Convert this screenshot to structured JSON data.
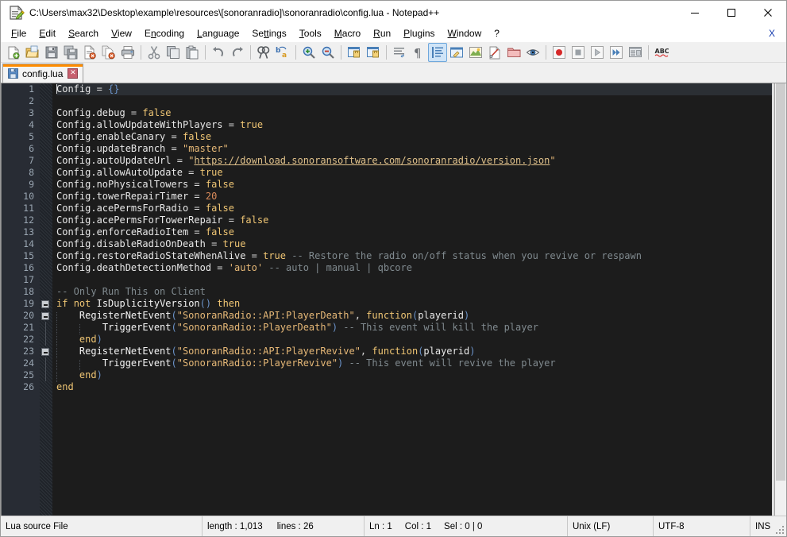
{
  "window": {
    "title": "C:\\Users\\max32\\Desktop\\example\\resources\\[sonoranradio]\\sonoranradio\\config.lua - Notepad++",
    "icon": "notepad-plus-plus-icon",
    "minimize_label": "—",
    "maximize_label": "☐",
    "close_label": "✕"
  },
  "menu": {
    "items": [
      {
        "label": "File",
        "accel": "F"
      },
      {
        "label": "Edit",
        "accel": "E"
      },
      {
        "label": "Search",
        "accel": "S"
      },
      {
        "label": "View",
        "accel": "V"
      },
      {
        "label": "Encoding",
        "accel": "n"
      },
      {
        "label": "Language",
        "accel": "L"
      },
      {
        "label": "Settings",
        "accel": "t"
      },
      {
        "label": "Tools",
        "accel": "T"
      },
      {
        "label": "Macro",
        "accel": "M"
      },
      {
        "label": "Run",
        "accel": "R"
      },
      {
        "label": "Plugins",
        "accel": "P"
      },
      {
        "label": "Window",
        "accel": "W"
      },
      {
        "label": "?",
        "accel": ""
      }
    ],
    "close_doc_label": "X"
  },
  "toolbar": {
    "buttons": [
      {
        "name": "new-file-icon",
        "tooltip": "New"
      },
      {
        "name": "open-file-icon",
        "tooltip": "Open"
      },
      {
        "name": "save-icon",
        "tooltip": "Save"
      },
      {
        "name": "save-all-icon",
        "tooltip": "Save All"
      },
      {
        "name": "close-file-icon",
        "tooltip": "Close"
      },
      {
        "name": "close-all-files-icon",
        "tooltip": "Close All"
      },
      {
        "name": "print-icon",
        "tooltip": "Print"
      },
      {
        "name": "cut-icon",
        "tooltip": "Cut"
      },
      {
        "name": "copy-icon",
        "tooltip": "Copy"
      },
      {
        "name": "paste-icon",
        "tooltip": "Paste"
      },
      {
        "name": "undo-icon",
        "tooltip": "Undo"
      },
      {
        "name": "redo-icon",
        "tooltip": "Redo"
      },
      {
        "name": "find-icon",
        "tooltip": "Find"
      },
      {
        "name": "replace-icon",
        "tooltip": "Replace"
      },
      {
        "name": "zoom-in-icon",
        "tooltip": "Zoom In"
      },
      {
        "name": "zoom-out-icon",
        "tooltip": "Zoom Out"
      },
      {
        "name": "sync-vertical-scrolling-icon",
        "tooltip": "Synchronize Vertical Scrolling"
      },
      {
        "name": "sync-horizontal-scrolling-icon",
        "tooltip": "Synchronize Horizontal Scrolling"
      },
      {
        "name": "word-wrap-icon",
        "tooltip": "Word wrap"
      },
      {
        "name": "show-all-characters-icon",
        "tooltip": "Show All Characters"
      },
      {
        "name": "indent-guide-icon",
        "tooltip": "Show Indent Guide",
        "active": true
      },
      {
        "name": "ui-display-icon",
        "tooltip": "Show UI"
      },
      {
        "name": "document-map-icon",
        "tooltip": "Document Map"
      },
      {
        "name": "function-list-icon",
        "tooltip": "Function List"
      },
      {
        "name": "folder-workspace-icon",
        "tooltip": "Folder as Workspace"
      },
      {
        "name": "monitoring-icon",
        "tooltip": "Monitoring (tail -f)"
      },
      {
        "name": "macro-record-icon",
        "tooltip": "Start Recording"
      },
      {
        "name": "macro-stop-icon",
        "tooltip": "Stop Recording"
      },
      {
        "name": "macro-play-icon",
        "tooltip": "Playback"
      },
      {
        "name": "macro-run-multiple-icon",
        "tooltip": "Run a Macro Multiple Times"
      },
      {
        "name": "macro-save-icon",
        "tooltip": "Save Current Recorded Macro"
      },
      {
        "name": "spell-check-icon",
        "tooltip": "Spell Checker"
      }
    ]
  },
  "tabs": [
    {
      "label": "config.lua",
      "icon": "saved-file-icon",
      "close": "✕",
      "active": true
    }
  ],
  "editor": {
    "theme": {
      "background": "#1c1c1c",
      "gutter_background": "#282c34",
      "line_number_color": "#9aa6b2",
      "current_line_background": "#2b2f34",
      "default_text": "#dfe1e4",
      "keyword": "#f0c674",
      "string": "#e6b877",
      "number": "#d88a5a",
      "comment": "#808a8f",
      "operator": "#d8d8d8",
      "bracket": "#6b93c9"
    },
    "lines": [
      {
        "n": 1,
        "indent": 0,
        "fold": "",
        "cur": true,
        "tokens": [
          {
            "t": "caret"
          },
          {
            "c": "id",
            "v": "Config"
          },
          {
            "c": "op",
            "v": " = "
          },
          {
            "c": "par",
            "v": "{}"
          }
        ]
      },
      {
        "n": 2,
        "indent": 0,
        "fold": "",
        "tokens": []
      },
      {
        "n": 3,
        "indent": 0,
        "fold": "",
        "tokens": [
          {
            "c": "id",
            "v": "Config.debug"
          },
          {
            "c": "op",
            "v": " = "
          },
          {
            "c": "kw",
            "v": "false"
          }
        ]
      },
      {
        "n": 4,
        "indent": 0,
        "fold": "",
        "tokens": [
          {
            "c": "id",
            "v": "Config.allowUpdateWithPlayers"
          },
          {
            "c": "op",
            "v": " = "
          },
          {
            "c": "kw",
            "v": "true"
          }
        ]
      },
      {
        "n": 5,
        "indent": 0,
        "fold": "",
        "tokens": [
          {
            "c": "id",
            "v": "Config.enableCanary"
          },
          {
            "c": "op",
            "v": " = "
          },
          {
            "c": "kw",
            "v": "false"
          }
        ]
      },
      {
        "n": 6,
        "indent": 0,
        "fold": "",
        "tokens": [
          {
            "c": "id",
            "v": "Config.updateBranch"
          },
          {
            "c": "op",
            "v": " = "
          },
          {
            "c": "str",
            "v": "\"master\""
          }
        ]
      },
      {
        "n": 7,
        "indent": 0,
        "fold": "",
        "tokens": [
          {
            "c": "id",
            "v": "Config.autoUpdateUrl"
          },
          {
            "c": "op",
            "v": " = "
          },
          {
            "c": "str",
            "v": "\""
          },
          {
            "c": "link",
            "v": "https://download.sonoransoftware.com/sonoranradio/version.json"
          },
          {
            "c": "str",
            "v": "\""
          }
        ]
      },
      {
        "n": 8,
        "indent": 0,
        "fold": "",
        "tokens": [
          {
            "c": "id",
            "v": "Config.allowAutoUpdate"
          },
          {
            "c": "op",
            "v": " = "
          },
          {
            "c": "kw",
            "v": "true"
          }
        ]
      },
      {
        "n": 9,
        "indent": 0,
        "fold": "",
        "tokens": [
          {
            "c": "id",
            "v": "Config.noPhysicalTowers"
          },
          {
            "c": "op",
            "v": " = "
          },
          {
            "c": "kw",
            "v": "false"
          }
        ]
      },
      {
        "n": 10,
        "indent": 0,
        "fold": "",
        "tokens": [
          {
            "c": "id",
            "v": "Config.towerRepairTimer"
          },
          {
            "c": "op",
            "v": " = "
          },
          {
            "c": "num",
            "v": "20"
          }
        ]
      },
      {
        "n": 11,
        "indent": 0,
        "fold": "",
        "tokens": [
          {
            "c": "id",
            "v": "Config.acePermsForRadio"
          },
          {
            "c": "op",
            "v": " = "
          },
          {
            "c": "kw",
            "v": "false"
          }
        ]
      },
      {
        "n": 12,
        "indent": 0,
        "fold": "",
        "tokens": [
          {
            "c": "id",
            "v": "Config.acePermsForTowerRepair"
          },
          {
            "c": "op",
            "v": " = "
          },
          {
            "c": "kw",
            "v": "false"
          }
        ]
      },
      {
        "n": 13,
        "indent": 0,
        "fold": "",
        "tokens": [
          {
            "c": "id",
            "v": "Config.enforceRadioItem"
          },
          {
            "c": "op",
            "v": " = "
          },
          {
            "c": "kw",
            "v": "false"
          }
        ]
      },
      {
        "n": 14,
        "indent": 0,
        "fold": "",
        "tokens": [
          {
            "c": "id",
            "v": "Config.disableRadioOnDeath"
          },
          {
            "c": "op",
            "v": " = "
          },
          {
            "c": "kw",
            "v": "true"
          }
        ]
      },
      {
        "n": 15,
        "indent": 0,
        "fold": "",
        "tokens": [
          {
            "c": "id",
            "v": "Config.restoreRadioStateWhenAlive"
          },
          {
            "c": "op",
            "v": " = "
          },
          {
            "c": "kw",
            "v": "true"
          },
          {
            "c": "com",
            "v": " -- Restore the radio on/off status when you revive or respawn"
          }
        ]
      },
      {
        "n": 16,
        "indent": 0,
        "fold": "",
        "tokens": [
          {
            "c": "id",
            "v": "Config.deathDetectionMethod"
          },
          {
            "c": "op",
            "v": " = "
          },
          {
            "c": "str",
            "v": "'auto'"
          },
          {
            "c": "com",
            "v": " -- auto | manual | qbcore"
          }
        ]
      },
      {
        "n": 17,
        "indent": 0,
        "fold": "",
        "tokens": []
      },
      {
        "n": 18,
        "indent": 0,
        "fold": "",
        "tokens": [
          {
            "c": "com",
            "v": "-- Only Run This on Client"
          }
        ]
      },
      {
        "n": 19,
        "indent": 0,
        "fold": "box",
        "tokens": [
          {
            "c": "kw",
            "v": "if"
          },
          {
            "c": "op",
            "v": " "
          },
          {
            "c": "kw",
            "v": "not"
          },
          {
            "c": "op",
            "v": " "
          },
          {
            "c": "fn",
            "v": "IsDuplicityVersion"
          },
          {
            "c": "par",
            "v": "()"
          },
          {
            "c": "op",
            "v": " "
          },
          {
            "c": "kw",
            "v": "then"
          }
        ]
      },
      {
        "n": 20,
        "indent": 1,
        "fold": "box",
        "tokens": [
          {
            "c": "fn",
            "v": "RegisterNetEvent"
          },
          {
            "c": "par",
            "v": "("
          },
          {
            "c": "str",
            "v": "\"SonoranRadio::API:PlayerDeath\""
          },
          {
            "c": "op",
            "v": ", "
          },
          {
            "c": "kw",
            "v": "function"
          },
          {
            "c": "par",
            "v": "("
          },
          {
            "c": "id",
            "v": "playerid"
          },
          {
            "c": "par",
            "v": ")"
          }
        ]
      },
      {
        "n": 21,
        "indent": 2,
        "fold": "bar",
        "tokens": [
          {
            "c": "fn",
            "v": "TriggerEvent"
          },
          {
            "c": "par",
            "v": "("
          },
          {
            "c": "str",
            "v": "\"SonoranRadio::PlayerDeath\""
          },
          {
            "c": "par",
            "v": ")"
          },
          {
            "c": "com",
            "v": " -- This event will kill the player"
          }
        ]
      },
      {
        "n": 22,
        "indent": 1,
        "fold": "bar",
        "tokens": [
          {
            "c": "kw",
            "v": "end"
          },
          {
            "c": "par",
            "v": ")"
          }
        ]
      },
      {
        "n": 23,
        "indent": 1,
        "fold": "box",
        "tokens": [
          {
            "c": "fn",
            "v": "RegisterNetEvent"
          },
          {
            "c": "par",
            "v": "("
          },
          {
            "c": "str",
            "v": "\"SonoranRadio::API:PlayerRevive\""
          },
          {
            "c": "op",
            "v": ", "
          },
          {
            "c": "kw",
            "v": "function"
          },
          {
            "c": "par",
            "v": "("
          },
          {
            "c": "id",
            "v": "playerid"
          },
          {
            "c": "par",
            "v": ")"
          }
        ]
      },
      {
        "n": 24,
        "indent": 2,
        "fold": "bar",
        "tokens": [
          {
            "c": "fn",
            "v": "TriggerEvent"
          },
          {
            "c": "par",
            "v": "("
          },
          {
            "c": "str",
            "v": "\"SonoranRadio::PlayerRevive\""
          },
          {
            "c": "par",
            "v": ")"
          },
          {
            "c": "com",
            "v": " -- This event will revive the player"
          }
        ]
      },
      {
        "n": 25,
        "indent": 1,
        "fold": "bar",
        "tokens": [
          {
            "c": "kw",
            "v": "end"
          },
          {
            "c": "par",
            "v": ")"
          }
        ]
      },
      {
        "n": 26,
        "indent": 0,
        "fold": "",
        "tokens": [
          {
            "c": "kw",
            "v": "end"
          }
        ]
      }
    ]
  },
  "statusbar": {
    "doc_type": "Lua source File",
    "length_label": "length : 1,013",
    "lines_label": "lines : 26",
    "ln": "Ln : 1",
    "col": "Col : 1",
    "sel": "Sel : 0 | 0",
    "eol": "Unix (LF)",
    "encoding": "UTF-8",
    "insert_mode": "INS"
  }
}
